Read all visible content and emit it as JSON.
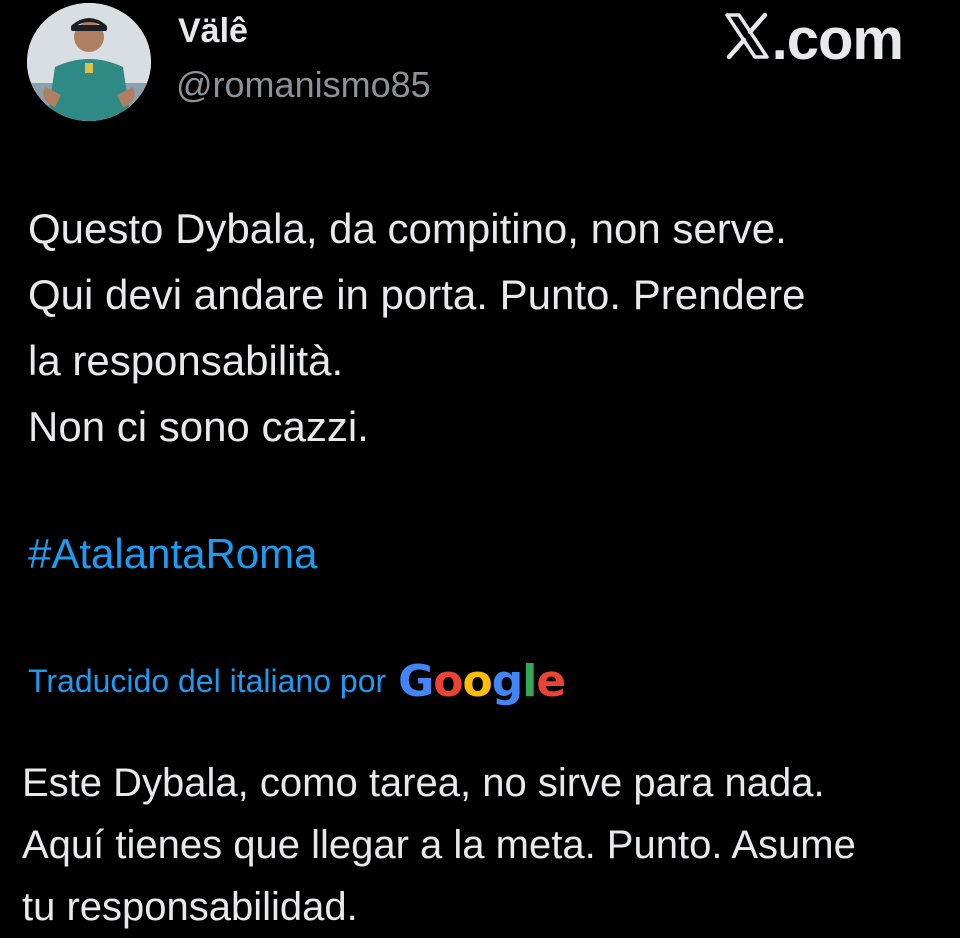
{
  "author": {
    "display_name": "Välê",
    "handle": "@romanismo85"
  },
  "brand": {
    "suffix": ".com",
    "icon": "x-logo-icon"
  },
  "tweet": {
    "lines": [
      "Questo Dybala, da compitino, non serve.",
      "Qui devi andare in porta. Punto. Prendere",
      "la responsabilità.",
      "Non ci sono cazzi."
    ],
    "hashtag": "#AtalantaRoma"
  },
  "translation": {
    "label": "Traducido del italiano por",
    "provider_letters": [
      {
        "char": "G",
        "color": "#4285F4"
      },
      {
        "char": "o",
        "color": "#EA4335"
      },
      {
        "char": "o",
        "color": "#FBBC05"
      },
      {
        "char": "g",
        "color": "#4285F4"
      },
      {
        "char": "l",
        "color": "#34A853"
      },
      {
        "char": "e",
        "color": "#EA4335"
      }
    ],
    "lines": [
      "Este Dybala, como tarea, no sirve para nada.",
      "Aquí tienes que llegar a la meta. Punto. Asume",
      "tu responsabilidad."
    ]
  },
  "colors": {
    "background": "#000000",
    "text": "#e7e9ea",
    "secondary": "#8b9298",
    "link": "#1d9bf0"
  }
}
